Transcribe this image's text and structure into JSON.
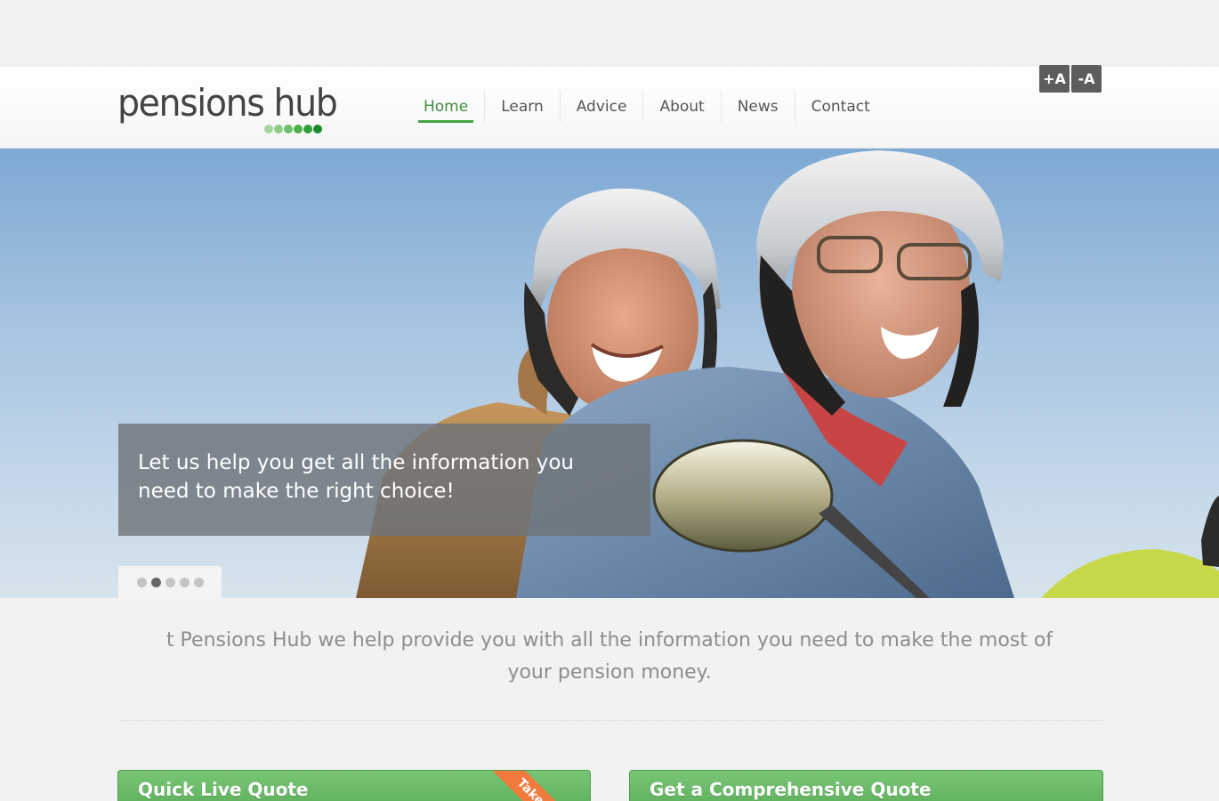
{
  "brand": {
    "logo_text": "pensions hub",
    "accent": "#42a942"
  },
  "nav": {
    "items": [
      {
        "label": "Home",
        "active": true
      },
      {
        "label": "Learn",
        "active": false
      },
      {
        "label": "Advice",
        "active": false
      },
      {
        "label": "About",
        "active": false
      },
      {
        "label": "News",
        "active": false
      },
      {
        "label": "Contact",
        "active": false
      }
    ]
  },
  "font_controls": {
    "increase": "+A",
    "decrease": "-A"
  },
  "hero": {
    "caption": "Let us help you get all the information you need to make the right choice!",
    "slides_count": 5,
    "active_slide": 2
  },
  "intro_text": "t Pensions Hub we help provide you with all the information you need to make the most of your pension money.",
  "quotes": {
    "quick_title": "Quick Live Quote",
    "quick_ribbon": "Takes",
    "comprehensive_title": "Get a Comprehensive Quote",
    "box_color": "#5fb35d",
    "ribbon_color": "#f07b3c"
  }
}
